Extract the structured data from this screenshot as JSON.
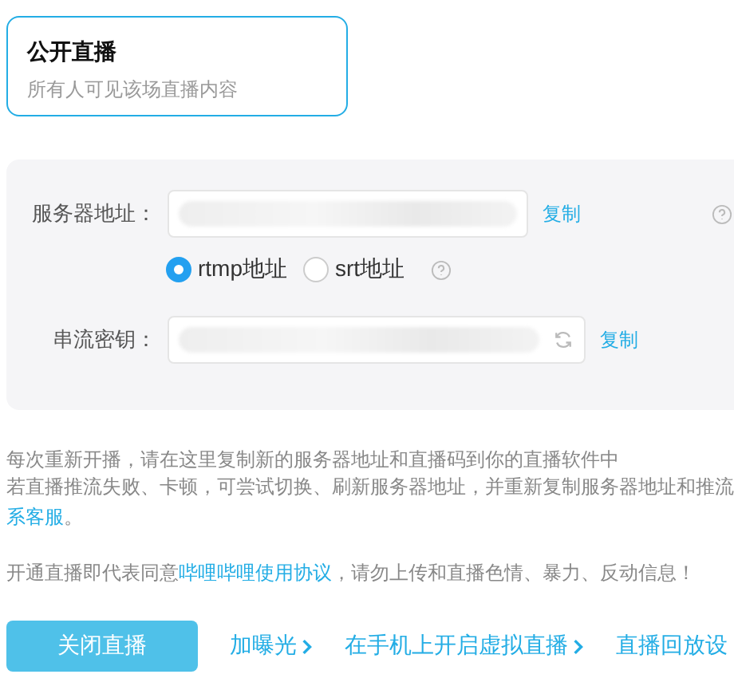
{
  "privacy_card": {
    "title": "公开直播",
    "description": "所有人可见该场直播内容",
    "selected": true
  },
  "settings": {
    "server_label": "服务器地址：",
    "server_copy": "复制",
    "protocols": [
      {
        "label": "rtmp地址",
        "selected": true
      },
      {
        "label": "srt地址",
        "selected": false
      }
    ],
    "key_label": "串流密钥：",
    "key_copy": "复制"
  },
  "notes": {
    "line_1": "每次重新开播，请在这里复制新的服务器地址和直播码到你的直播软件中",
    "line_2": "若直播推流失败、卡顿，可尝试切换、刷新服务器地址，并重新复制服务器地址和推流",
    "line_3_link": "系客服",
    "line_3_end": "。"
  },
  "agreement": {
    "before": "开通直播即代表同意",
    "link": "哔哩哔哩使用协议",
    "after": "，请勿上传和直播色情、暴力、反动信息！"
  },
  "actions": {
    "primary": "关闭直播",
    "links": [
      "加曝光",
      "在手机上开启虚拟直播",
      "直播回放设"
    ]
  }
}
